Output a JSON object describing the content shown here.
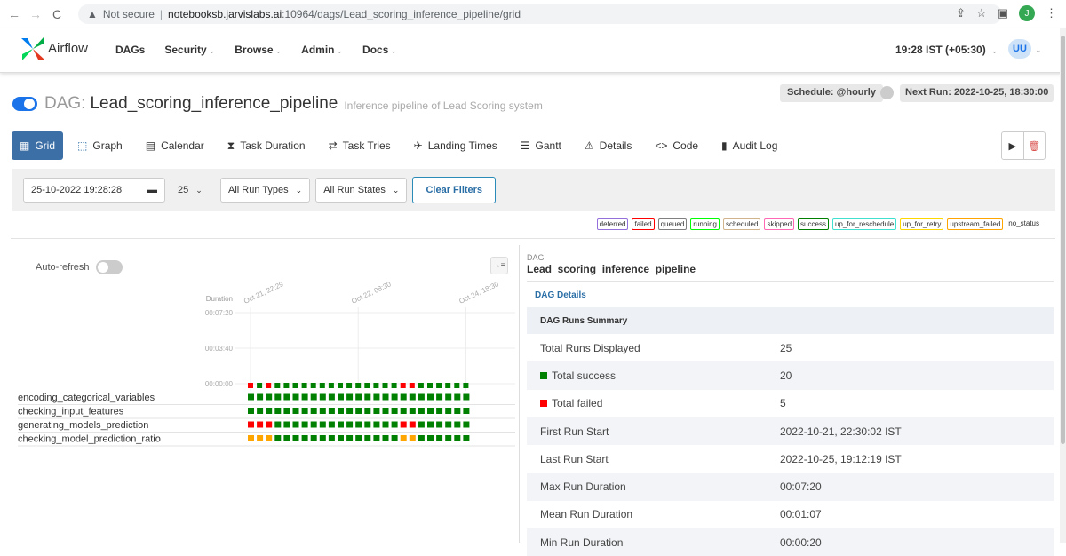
{
  "browser": {
    "security_label": "Not secure",
    "url_host": "notebooksb.jarvislabs.ai",
    "url_path": ":10964/dags/Lead_scoring_inference_pipeline/grid",
    "profile_initial": "J"
  },
  "navbar": {
    "brand": "Airflow",
    "menu": [
      {
        "label": "DAGs",
        "dropdown": false
      },
      {
        "label": "Security",
        "dropdown": true
      },
      {
        "label": "Browse",
        "dropdown": true
      },
      {
        "label": "Admin",
        "dropdown": true
      },
      {
        "label": "Docs",
        "dropdown": true
      }
    ],
    "time": "19:28 IST (+05:30)",
    "user_initials": "UU",
    "brand_colors": [
      "#017cee",
      "#00ad46",
      "#e43921",
      "#04d659"
    ]
  },
  "dag": {
    "label": "DAG:",
    "name": "Lead_scoring_inference_pipeline",
    "description": "Inference pipeline of Lead Scoring system",
    "schedule": "Schedule: @hourly",
    "next_run": "Next Run: 2022-10-25, 18:30:00",
    "active": true
  },
  "tabs": [
    {
      "label": "Grid",
      "icon": "grid-icon",
      "active": true
    },
    {
      "label": "Graph",
      "icon": "graph-icon",
      "active": false
    },
    {
      "label": "Calendar",
      "icon": "calendar-icon",
      "active": false
    },
    {
      "label": "Task Duration",
      "icon": "hourglass-icon",
      "active": false
    },
    {
      "label": "Task Tries",
      "icon": "retry-icon",
      "active": false
    },
    {
      "label": "Landing Times",
      "icon": "landing-icon",
      "active": false
    },
    {
      "label": "Gantt",
      "icon": "gantt-icon",
      "active": false
    },
    {
      "label": "Details",
      "icon": "warning-triangle-icon",
      "active": false
    },
    {
      "label": "Code",
      "icon": "code-icon",
      "active": false
    },
    {
      "label": "Audit Log",
      "icon": "file-icon",
      "active": false
    }
  ],
  "filters": {
    "date": "25-10-2022 19:28:28",
    "num_runs": "25",
    "run_types": "All Run Types",
    "run_states": "All Run States",
    "clear": "Clear Filters"
  },
  "legend": [
    {
      "label": "deferred",
      "color": "#9370db"
    },
    {
      "label": "failed",
      "color": "#ff0000"
    },
    {
      "label": "queued",
      "color": "#808080"
    },
    {
      "label": "running",
      "color": "#00ff00"
    },
    {
      "label": "scheduled",
      "color": "#d2b48c"
    },
    {
      "label": "skipped",
      "color": "#ff69b4"
    },
    {
      "label": "success",
      "color": "#008000"
    },
    {
      "label": "up_for_reschedule",
      "color": "#40e0d0"
    },
    {
      "label": "up_for_retry",
      "color": "#ffd700"
    },
    {
      "label": "upstream_failed",
      "color": "#ffa500"
    },
    {
      "label": "no_status",
      "color": ""
    }
  ],
  "grid": {
    "auto_refresh": "Auto-refresh",
    "duration_label": "Duration",
    "y_ticks": [
      "00:07:20",
      "00:03:40",
      "00:00:00"
    ],
    "date_labels": [
      "Oct 21, 22:29",
      "Oct 22, 08:30",
      "Oct 24, 18:30"
    ],
    "run_durations_sec": [
      20,
      20,
      20,
      20,
      20,
      20,
      20,
      20,
      20,
      20,
      20,
      20,
      22,
      20,
      20,
      20,
      20,
      20,
      20,
      20,
      20,
      20,
      20,
      20,
      20
    ],
    "run_states": [
      "failed",
      "success",
      "failed",
      "success",
      "success",
      "success",
      "success",
      "success",
      "success",
      "success",
      "success",
      "success",
      "success",
      "success",
      "success",
      "success",
      "success",
      "failed",
      "failed",
      "success",
      "success",
      "success",
      "success",
      "success",
      "success"
    ],
    "tasks": [
      {
        "name": "encoding_categorical_variables",
        "states": [
          "success",
          "success",
          "success",
          "success",
          "success",
          "success",
          "success",
          "success",
          "success",
          "success",
          "success",
          "success",
          "success",
          "success",
          "success",
          "success",
          "success",
          "success",
          "success",
          "success",
          "success",
          "success",
          "success",
          "success",
          "success"
        ]
      },
      {
        "name": "checking_input_features",
        "states": [
          "success",
          "success",
          "success",
          "success",
          "success",
          "success",
          "success",
          "success",
          "success",
          "success",
          "success",
          "success",
          "success",
          "success",
          "success",
          "success",
          "success",
          "success",
          "success",
          "success",
          "success",
          "success",
          "success",
          "success",
          "success"
        ]
      },
      {
        "name": "generating_models_prediction",
        "states": [
          "failed",
          "failed",
          "failed",
          "success",
          "success",
          "success",
          "success",
          "success",
          "success",
          "success",
          "success",
          "success",
          "success",
          "success",
          "success",
          "success",
          "success",
          "failed",
          "failed",
          "success",
          "success",
          "success",
          "success",
          "success",
          "success"
        ]
      },
      {
        "name": "checking_model_prediction_ratio",
        "states": [
          "upstream_failed",
          "upstream_failed",
          "upstream_failed",
          "success",
          "success",
          "success",
          "success",
          "success",
          "success",
          "success",
          "success",
          "success",
          "success",
          "success",
          "success",
          "success",
          "success",
          "upstream_failed",
          "upstream_failed",
          "success",
          "success",
          "success",
          "success",
          "success",
          "success"
        ]
      }
    ]
  },
  "details": {
    "header_small": "DAG",
    "header": "Lead_scoring_inference_pipeline",
    "tab": "DAG Details",
    "summary_title": "DAG Runs Summary",
    "rows": [
      {
        "label": "Total Runs Displayed",
        "value": "25",
        "square": ""
      },
      {
        "label": "Total success",
        "value": "20",
        "square": "#008000"
      },
      {
        "label": "Total failed",
        "value": "5",
        "square": "#ff0000"
      },
      {
        "label": "First Run Start",
        "value": "2022-10-21, 22:30:02 IST",
        "square": ""
      },
      {
        "label": "Last Run Start",
        "value": "2022-10-25, 19:12:19 IST",
        "square": ""
      },
      {
        "label": "Max Run Duration",
        "value": "00:07:20",
        "square": ""
      },
      {
        "label": "Mean Run Duration",
        "value": "00:01:07",
        "square": ""
      },
      {
        "label": "Min Run Duration",
        "value": "00:00:20",
        "square": ""
      }
    ]
  }
}
